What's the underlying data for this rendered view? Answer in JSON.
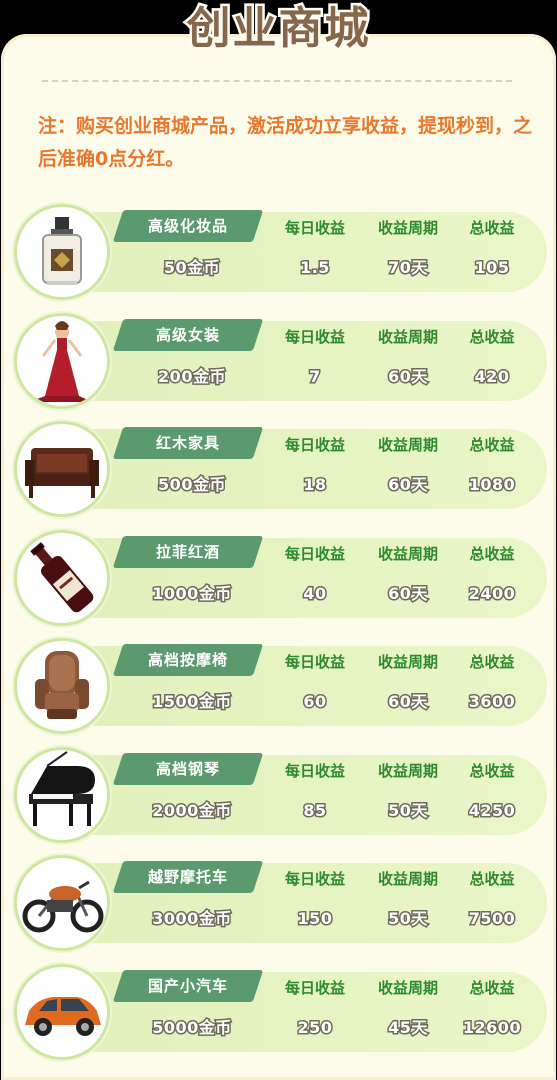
{
  "page": {
    "title": "创业商城",
    "notice": "注：购买创业商城产品，激活成功立享收益，提现秒到，之后准确0点分红。"
  },
  "headers": {
    "daily": "每日收益",
    "period": "收益周期",
    "total": "总收益"
  },
  "products": [
    {
      "name": "高级化妆品",
      "price": "50金币",
      "daily": "1.5",
      "period": "70天",
      "total": "105",
      "icon": "perfume-bottle-icon"
    },
    {
      "name": "高级女装",
      "price": "200金币",
      "daily": "7",
      "period": "60天",
      "total": "420",
      "icon": "red-dress-icon"
    },
    {
      "name": "红木家具",
      "price": "500金币",
      "daily": "18",
      "period": "60天",
      "total": "1080",
      "icon": "wooden-sofa-icon"
    },
    {
      "name": "拉菲红酒",
      "price": "1000金币",
      "daily": "40",
      "period": "60天",
      "total": "2400",
      "icon": "wine-bottle-icon"
    },
    {
      "name": "高档按摩椅",
      "price": "1500金币",
      "daily": "60",
      "period": "60天",
      "total": "3600",
      "icon": "massage-chair-icon"
    },
    {
      "name": "高档钢琴",
      "price": "2000金币",
      "daily": "85",
      "period": "50天",
      "total": "4250",
      "icon": "grand-piano-icon"
    },
    {
      "name": "越野摩托车",
      "price": "3000金币",
      "daily": "150",
      "period": "50天",
      "total": "7500",
      "icon": "motorcycle-icon"
    },
    {
      "name": "国产小汽车",
      "price": "5000金币",
      "daily": "250",
      "period": "45天",
      "total": "12600",
      "icon": "car-icon"
    }
  ]
}
